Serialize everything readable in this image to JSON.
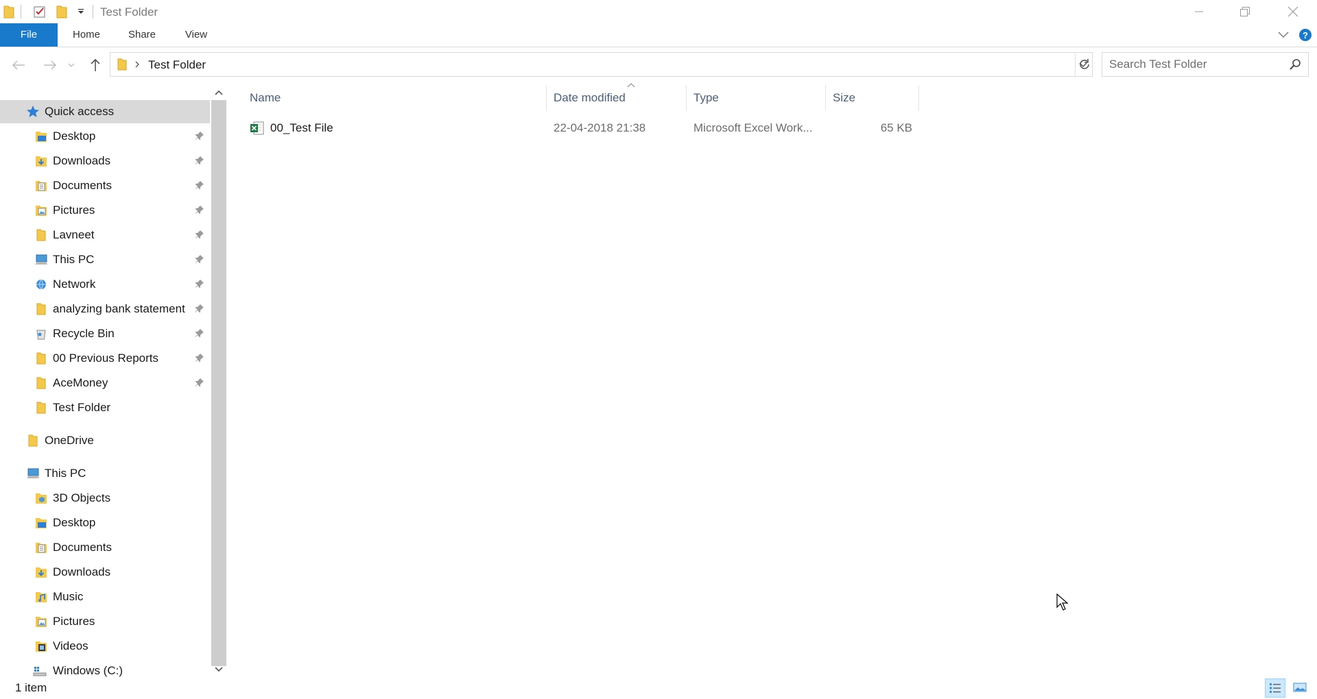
{
  "window": {
    "title": "Test Folder",
    "controls": [
      "minimize",
      "restore",
      "close"
    ]
  },
  "ribbon": {
    "tabs": [
      {
        "label": "File",
        "active": true
      },
      {
        "label": "Home"
      },
      {
        "label": "Share"
      },
      {
        "label": "View"
      }
    ]
  },
  "address_bar": {
    "path": [
      "Test Folder"
    ]
  },
  "search": {
    "placeholder": "Search Test Folder"
  },
  "nav_pane": {
    "quick_access": {
      "label": "Quick access",
      "items": [
        {
          "label": "Desktop",
          "icon": "desktop-folder-icon",
          "pinned": true
        },
        {
          "label": "Downloads",
          "icon": "downloads-folder-icon",
          "pinned": true
        },
        {
          "label": "Documents",
          "icon": "documents-folder-icon",
          "pinned": true
        },
        {
          "label": "Pictures",
          "icon": "pictures-folder-icon",
          "pinned": true
        },
        {
          "label": "Lavneet",
          "icon": "folder-icon",
          "pinned": true
        },
        {
          "label": "This PC",
          "icon": "computer-icon",
          "pinned": true
        },
        {
          "label": "Network",
          "icon": "network-icon",
          "pinned": true
        },
        {
          "label": "analyzing bank statement",
          "icon": "folder-icon",
          "pinned": true
        },
        {
          "label": "Recycle Bin",
          "icon": "recycle-bin-icon",
          "pinned": true
        },
        {
          "label": "00 Previous Reports",
          "icon": "folder-icon",
          "pinned": true
        },
        {
          "label": "AceMoney",
          "icon": "folder-icon",
          "pinned": true
        },
        {
          "label": "Test Folder",
          "icon": "folder-icon",
          "pinned": false
        }
      ]
    },
    "onedrive": {
      "label": "OneDrive"
    },
    "this_pc": {
      "label": "This PC",
      "items": [
        {
          "label": "3D Objects",
          "icon": "3d-objects-folder-icon"
        },
        {
          "label": "Desktop",
          "icon": "desktop-folder-icon"
        },
        {
          "label": "Documents",
          "icon": "documents-folder-icon"
        },
        {
          "label": "Downloads",
          "icon": "downloads-folder-icon"
        },
        {
          "label": "Music",
          "icon": "music-folder-icon"
        },
        {
          "label": "Pictures",
          "icon": "pictures-folder-icon"
        },
        {
          "label": "Videos",
          "icon": "videos-folder-icon"
        },
        {
          "label": "Windows (C:)",
          "icon": "drive-icon"
        }
      ]
    }
  },
  "file_list": {
    "columns": [
      "Name",
      "Date modified",
      "Type",
      "Size"
    ],
    "sorted_by": "Name",
    "files": [
      {
        "name": "00_Test File",
        "date_modified": "22-04-2018 21:38",
        "type": "Microsoft Excel Work...",
        "size": "65 KB",
        "icon": "excel-file-icon"
      }
    ]
  },
  "status_bar": {
    "item_count": "1 item",
    "view_mode": "details"
  },
  "colors": {
    "file_tab": "#1979ca",
    "selected_nav": "#d9d9d9",
    "column_header_text": "#4c607a",
    "folder_yellow": "#f4c84a"
  }
}
